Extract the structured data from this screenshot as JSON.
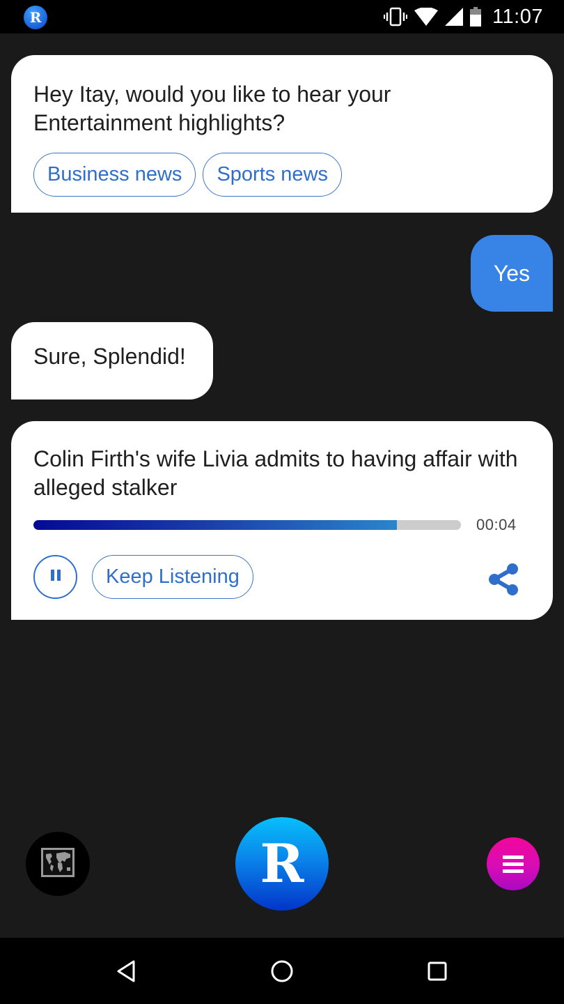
{
  "status_bar": {
    "app_icon": "rebbit-r-logo",
    "icons": [
      "vibrate-icon",
      "wifi-icon",
      "signal-icon",
      "battery-icon"
    ],
    "time": "11:07",
    "app_logo_letter": "R"
  },
  "conversation": {
    "greeting": {
      "text": "Hey Itay, would you like to hear your Entertainment highlights?",
      "chips": [
        {
          "label": "Business news"
        },
        {
          "label": "Sports news"
        }
      ]
    },
    "user_reply": {
      "text": "Yes"
    },
    "bot_reply": {
      "text": "Sure, Splendid!"
    },
    "news_card": {
      "headline": "Colin Firth's wife Livia admits to having affair with alleged stalker",
      "progress_percent": 85,
      "elapsed_time": "00:04",
      "pause_icon": "pause-icon",
      "keep_listening_label": "Keep Listening",
      "share_icon": "share-icon"
    }
  },
  "bottom_controls": {
    "map_icon": "world-map-icon",
    "main_button_letter": "R",
    "menu_icon": "hamburger-menu-icon"
  },
  "nav_bar": {
    "buttons": [
      "back",
      "home",
      "recents"
    ]
  },
  "colors": {
    "accent_blue": "#3783e6",
    "chip_blue": "#2f6fcb",
    "menu_pink": "#e00aa8",
    "background": "#1a1a1a"
  }
}
